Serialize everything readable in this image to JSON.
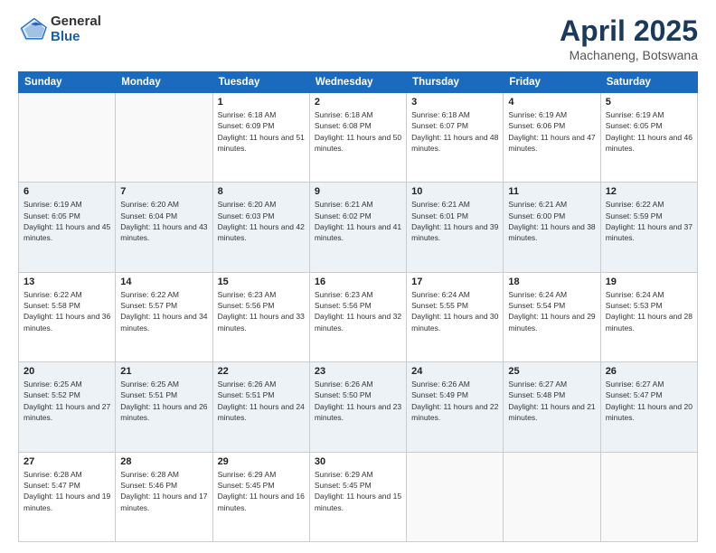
{
  "logo": {
    "general": "General",
    "blue": "Blue"
  },
  "title": "April 2025",
  "subtitle": "Machaneng, Botswana",
  "weekdays": [
    "Sunday",
    "Monday",
    "Tuesday",
    "Wednesday",
    "Thursday",
    "Friday",
    "Saturday"
  ],
  "weeks": [
    [
      {
        "day": "",
        "info": ""
      },
      {
        "day": "",
        "info": ""
      },
      {
        "day": "1",
        "info": "Sunrise: 6:18 AM\nSunset: 6:09 PM\nDaylight: 11 hours and 51 minutes."
      },
      {
        "day": "2",
        "info": "Sunrise: 6:18 AM\nSunset: 6:08 PM\nDaylight: 11 hours and 50 minutes."
      },
      {
        "day": "3",
        "info": "Sunrise: 6:18 AM\nSunset: 6:07 PM\nDaylight: 11 hours and 48 minutes."
      },
      {
        "day": "4",
        "info": "Sunrise: 6:19 AM\nSunset: 6:06 PM\nDaylight: 11 hours and 47 minutes."
      },
      {
        "day": "5",
        "info": "Sunrise: 6:19 AM\nSunset: 6:05 PM\nDaylight: 11 hours and 46 minutes."
      }
    ],
    [
      {
        "day": "6",
        "info": "Sunrise: 6:19 AM\nSunset: 6:05 PM\nDaylight: 11 hours and 45 minutes."
      },
      {
        "day": "7",
        "info": "Sunrise: 6:20 AM\nSunset: 6:04 PM\nDaylight: 11 hours and 43 minutes."
      },
      {
        "day": "8",
        "info": "Sunrise: 6:20 AM\nSunset: 6:03 PM\nDaylight: 11 hours and 42 minutes."
      },
      {
        "day": "9",
        "info": "Sunrise: 6:21 AM\nSunset: 6:02 PM\nDaylight: 11 hours and 41 minutes."
      },
      {
        "day": "10",
        "info": "Sunrise: 6:21 AM\nSunset: 6:01 PM\nDaylight: 11 hours and 39 minutes."
      },
      {
        "day": "11",
        "info": "Sunrise: 6:21 AM\nSunset: 6:00 PM\nDaylight: 11 hours and 38 minutes."
      },
      {
        "day": "12",
        "info": "Sunrise: 6:22 AM\nSunset: 5:59 PM\nDaylight: 11 hours and 37 minutes."
      }
    ],
    [
      {
        "day": "13",
        "info": "Sunrise: 6:22 AM\nSunset: 5:58 PM\nDaylight: 11 hours and 36 minutes."
      },
      {
        "day": "14",
        "info": "Sunrise: 6:22 AM\nSunset: 5:57 PM\nDaylight: 11 hours and 34 minutes."
      },
      {
        "day": "15",
        "info": "Sunrise: 6:23 AM\nSunset: 5:56 PM\nDaylight: 11 hours and 33 minutes."
      },
      {
        "day": "16",
        "info": "Sunrise: 6:23 AM\nSunset: 5:56 PM\nDaylight: 11 hours and 32 minutes."
      },
      {
        "day": "17",
        "info": "Sunrise: 6:24 AM\nSunset: 5:55 PM\nDaylight: 11 hours and 30 minutes."
      },
      {
        "day": "18",
        "info": "Sunrise: 6:24 AM\nSunset: 5:54 PM\nDaylight: 11 hours and 29 minutes."
      },
      {
        "day": "19",
        "info": "Sunrise: 6:24 AM\nSunset: 5:53 PM\nDaylight: 11 hours and 28 minutes."
      }
    ],
    [
      {
        "day": "20",
        "info": "Sunrise: 6:25 AM\nSunset: 5:52 PM\nDaylight: 11 hours and 27 minutes."
      },
      {
        "day": "21",
        "info": "Sunrise: 6:25 AM\nSunset: 5:51 PM\nDaylight: 11 hours and 26 minutes."
      },
      {
        "day": "22",
        "info": "Sunrise: 6:26 AM\nSunset: 5:51 PM\nDaylight: 11 hours and 24 minutes."
      },
      {
        "day": "23",
        "info": "Sunrise: 6:26 AM\nSunset: 5:50 PM\nDaylight: 11 hours and 23 minutes."
      },
      {
        "day": "24",
        "info": "Sunrise: 6:26 AM\nSunset: 5:49 PM\nDaylight: 11 hours and 22 minutes."
      },
      {
        "day": "25",
        "info": "Sunrise: 6:27 AM\nSunset: 5:48 PM\nDaylight: 11 hours and 21 minutes."
      },
      {
        "day": "26",
        "info": "Sunrise: 6:27 AM\nSunset: 5:47 PM\nDaylight: 11 hours and 20 minutes."
      }
    ],
    [
      {
        "day": "27",
        "info": "Sunrise: 6:28 AM\nSunset: 5:47 PM\nDaylight: 11 hours and 19 minutes."
      },
      {
        "day": "28",
        "info": "Sunrise: 6:28 AM\nSunset: 5:46 PM\nDaylight: 11 hours and 17 minutes."
      },
      {
        "day": "29",
        "info": "Sunrise: 6:29 AM\nSunset: 5:45 PM\nDaylight: 11 hours and 16 minutes."
      },
      {
        "day": "30",
        "info": "Sunrise: 6:29 AM\nSunset: 5:45 PM\nDaylight: 11 hours and 15 minutes."
      },
      {
        "day": "",
        "info": ""
      },
      {
        "day": "",
        "info": ""
      },
      {
        "day": "",
        "info": ""
      }
    ]
  ]
}
